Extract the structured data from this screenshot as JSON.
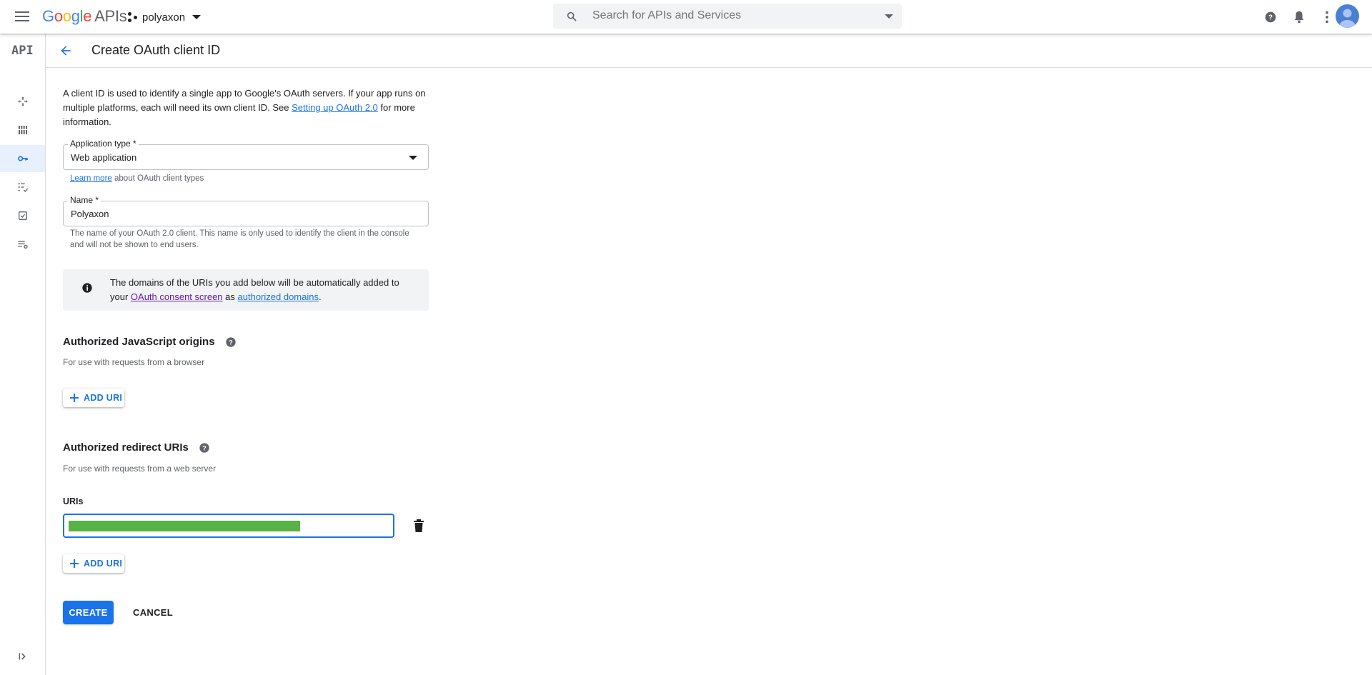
{
  "topbar": {
    "logo_google": "Google",
    "logo_apis": "APIs",
    "project_name": "polyaxon",
    "search_placeholder": "Search for APIs and Services"
  },
  "rail": {
    "logo": "API",
    "items": [
      "dashboard",
      "library",
      "credentials",
      "oauth-consent",
      "domain-verification",
      "page-usage-agreements"
    ],
    "active": "credentials"
  },
  "page": {
    "title": "Create OAuth client ID",
    "intro_part1": "A client ID is used to identify a single app to Google's OAuth servers. If your app runs on multiple platforms, each will need its own client ID. See ",
    "intro_link": "Setting up OAuth 2.0",
    "intro_part2": " for more information."
  },
  "app_type": {
    "label": "Application type *",
    "value": "Web application",
    "learn_more_link": "Learn more",
    "learn_more_suffix": " about OAuth client types"
  },
  "name_field": {
    "label": "Name *",
    "value": "Polyaxon",
    "hint": "The name of your OAuth 2.0 client. This name is only used to identify the client in the console and will not be shown to end users."
  },
  "info": {
    "text_part1": "The domains of the URIs you add below will be automatically added to your ",
    "link1": "OAuth consent screen",
    "text_part2": " as ",
    "link2": "authorized domains",
    "text_part3": "."
  },
  "js_origins": {
    "title": "Authorized JavaScript origins",
    "subtitle": "For use with requests from a browser",
    "add_label": "ADD URI"
  },
  "redirect_uris": {
    "title": "Authorized redirect URIs",
    "subtitle": "For use with requests from a web server",
    "uris_label": "URIs",
    "add_label": "ADD URI"
  },
  "actions": {
    "create": "CREATE",
    "cancel": "CANCEL"
  },
  "colors": {
    "accent": "#1a73e8",
    "visited_link": "#681da8",
    "redaction": "#57b346"
  }
}
